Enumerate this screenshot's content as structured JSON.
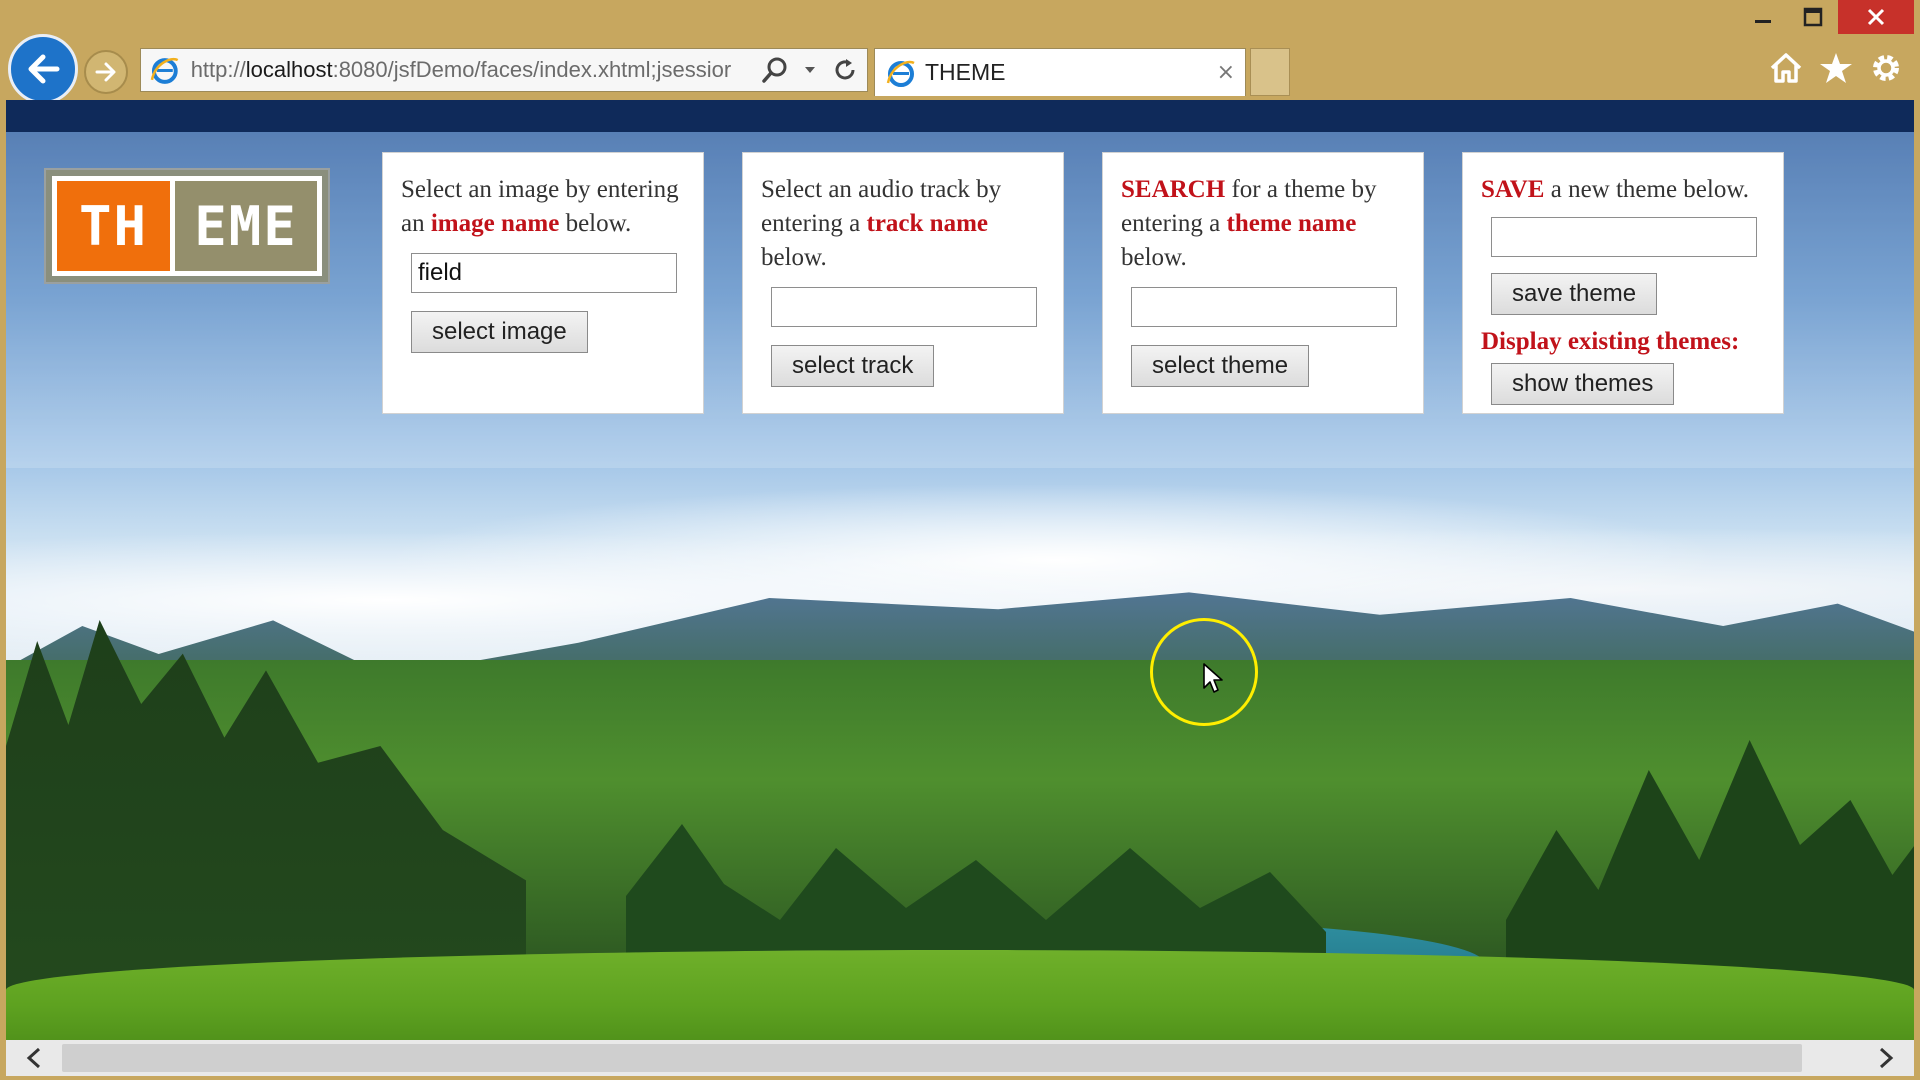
{
  "browser": {
    "url_prefix": "http://",
    "url_host": "localhost",
    "url_rest": ":8080/jsfDemo/faces/index.xhtml;jsessior",
    "tab_title": "THEME",
    "tab_close": "×"
  },
  "logo": {
    "left": "TH",
    "right": "EME"
  },
  "image_panel": {
    "text1": "Select an image by entering an ",
    "highlight": "image name",
    "text2": " below.",
    "input_value": "field",
    "button": "select image"
  },
  "track_panel": {
    "text1": "Select an audio track by entering a ",
    "highlight": "track name",
    "text2": " below.",
    "input_value": "",
    "button": "select track"
  },
  "search_panel": {
    "highlight1": "SEARCH",
    "text1": " for a theme by entering a ",
    "highlight2": "theme name",
    "text2": " below.",
    "input_value": "",
    "button": "select theme"
  },
  "save_panel": {
    "highlight": "SAVE",
    "text": " a new theme below.",
    "input_value": "",
    "button": "save theme",
    "display_label": "Display existing themes:",
    "show_button": "show themes"
  },
  "colors": {
    "accent_red": "#c1121a",
    "topbar": "#0f2a5a",
    "logo_orange": "#f06f0c",
    "chrome": "#c7a75f"
  }
}
